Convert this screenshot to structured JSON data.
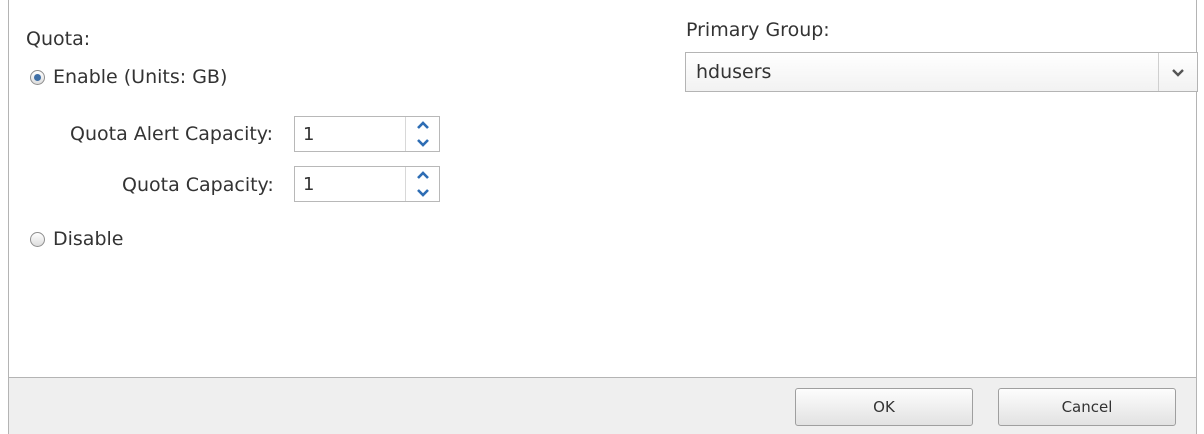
{
  "quota": {
    "title": "Quota:",
    "enable": {
      "label": "Enable (Units: GB)",
      "selected": true
    },
    "alert_capacity": {
      "label": "Quota Alert Capacity:",
      "value": "1"
    },
    "capacity": {
      "label": "Quota Capacity:",
      "value": "1"
    },
    "disable": {
      "label": "Disable",
      "selected": false
    }
  },
  "primary_group": {
    "label": "Primary Group:",
    "selected": "hdusers"
  },
  "footer": {
    "ok_label": "OK",
    "cancel_label": "Cancel"
  },
  "colors": {
    "radio_dot": "#3f6fa6",
    "spinner_arrow": "#2e6db4",
    "footer_bg": "#efefef",
    "border": "#b4b4b4"
  }
}
